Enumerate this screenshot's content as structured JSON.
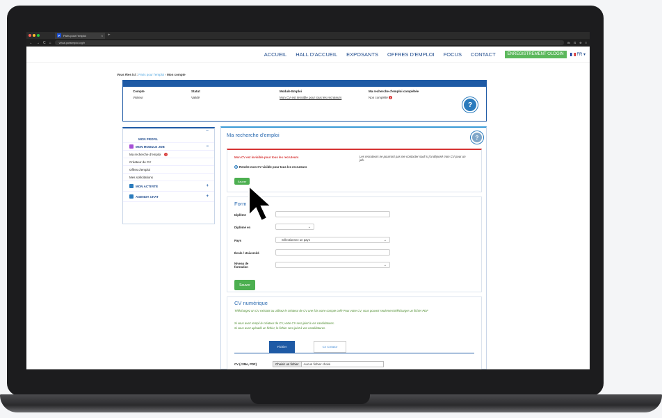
{
  "browser": {
    "tab_title": "Paris pour l'emploi",
    "tab_favicon": "P",
    "tab_close": "×",
    "new_tab": "+",
    "url": "virtual.parisemploi.org/fr",
    "nav_icons": [
      "back-icon",
      "forward-icon",
      "reload-icon",
      "home-icon"
    ],
    "nav_glyphs": [
      "←",
      "→",
      "C",
      "⌂"
    ],
    "ext_glyphs": [
      "IN",
      "⊡",
      "⊕",
      "≡"
    ]
  },
  "nav": {
    "items": [
      "ACCUEIL",
      "HALL D'ACCUEIL",
      "EXPOSANTS",
      "OFFRES D'EMPLOI",
      "FOCUS",
      "CONTACT"
    ],
    "register_label": "ENREGISTREMENT ⏻LOGIN",
    "lang_label": "FR",
    "lang_chevron": "▾"
  },
  "breadcrumb": {
    "prefix": "Vous êtes ici :",
    "link": "Paris pour l'emploi",
    "sep": "›",
    "current": "Mon compte"
  },
  "account": {
    "compte_h": "Compte",
    "compte_v": "Visiteur",
    "statut_h": "Statut",
    "statut_v": "Validé",
    "module_h": "Module Emploi",
    "module_v": "Mon CV est invisible pour tous les recruteurs",
    "recherche_h": "Ma recherche d'emploi complétée",
    "recherche_v": "Non complété",
    "help_glyph": "?"
  },
  "sidebar": {
    "collapse_glyph": "−",
    "plus_glyph": "+",
    "alert_glyph": "!",
    "profil": "MON PROFIL",
    "module_job": "MON MODULE JOB",
    "items": [
      "Ma recherche d'emploi",
      "Créateur de CV",
      "Offres d'emploi",
      "Mes sollicitations"
    ],
    "activite": "MON ACTIVITÉ",
    "agenda": "AGENDA CHAT"
  },
  "main": {
    "title": "Ma recherche d'emploi",
    "help_glyph": "?",
    "visibility": {
      "warning": "Mon CV est invisible pour tous les recruteurs",
      "note": "Les recruteurs ne pourront pas me contacter sauf si j'ai déposé mon CV pour un job.",
      "radio_label": "Rendre mon CV visible pour tous les recruteurs",
      "save": "Sauver"
    },
    "form": {
      "title": "Form",
      "diplome": "Diplôme",
      "diplome_en": "Diplômé en",
      "pays": "Pays",
      "pays_placeholder": "Sélectionnez un pays",
      "ecole": "École / Université",
      "niveau": "Niveau de formation",
      "chevron": "⌄",
      "save": "Sauver"
    },
    "cv": {
      "title": "CV numérique",
      "text1": "Téléchargez un CV existant ou utilisez le créateur de CV une fois votre compte créé Pour votre CV, vous pouvez seulement télécharger un fichier PDF",
      "text2": "Si vous avez rempli le créateur de CV, votre CV sera joint à vos candidatures.",
      "text3": "Si vous avez uploadé un fichier, le fichier sera joint à vos candidatures.",
      "tab_file": "Fichier",
      "tab_creator": "Cv Creator",
      "file_label": "CV (<2Mo, PDF)",
      "file_button": "Choisir un fichier",
      "file_name": "Aucun fichier choisi"
    }
  },
  "colors": {
    "brand_blue": "#1e5aa5",
    "link_blue": "#1e4a8c",
    "green": "#4caf50",
    "red": "#d63333"
  }
}
